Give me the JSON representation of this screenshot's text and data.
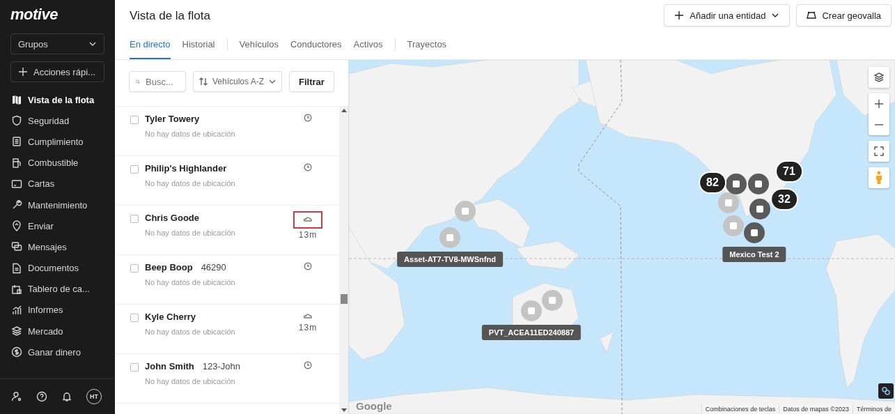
{
  "sidebar": {
    "logo": "motive",
    "groups_dropdown": "Grupos",
    "quick_actions": "Acciones rápi...",
    "nav": [
      {
        "label": "Vista de la flota",
        "selected": true
      },
      {
        "label": "Seguridad",
        "selected": false
      },
      {
        "label": "Cumplimiento",
        "selected": false
      },
      {
        "label": "Combustible",
        "selected": false
      },
      {
        "label": "Cartas",
        "selected": false
      },
      {
        "label": "Mantenimiento",
        "selected": false
      },
      {
        "label": "Enviar",
        "selected": false
      },
      {
        "label": "Mensajes",
        "selected": false
      },
      {
        "label": "Documentos",
        "selected": false
      },
      {
        "label": "Tablero de ca...",
        "selected": false
      },
      {
        "label": "Informes",
        "selected": false
      },
      {
        "label": "Mercado",
        "selected": false
      },
      {
        "label": "Ganar dinero",
        "selected": false
      }
    ],
    "avatar": "HT"
  },
  "header": {
    "title": "Vista de la flota",
    "buttons": [
      {
        "kind": "add",
        "label": "Añadir una entidad"
      },
      {
        "kind": "geofence",
        "label": "Crear geovalla"
      }
    ]
  },
  "tab_groups": [
    [
      {
        "label": "En directo",
        "selected": true
      },
      {
        "label": "Historial",
        "selected": false
      }
    ],
    [
      {
        "label": "Vehículos",
        "selected": false
      },
      {
        "label": "Conductores",
        "selected": false
      },
      {
        "label": "Activos",
        "selected": false
      }
    ],
    [
      {
        "label": "Trayectos",
        "selected": false
      }
    ]
  ],
  "toolbar": {
    "search": {
      "placeholder": "Busc..."
    },
    "sort": "Vehículos A-Z",
    "filter": "Filtrar"
  },
  "vehicles": [
    {
      "name": "Tyler Towery",
      "checked": false,
      "location": "No hay datos de ubicación",
      "kind": "clock",
      "highlighted": false
    },
    {
      "name": "Philip's Highlander",
      "checked": false,
      "location": "No hay datos de ubicación",
      "kind": "clock",
      "highlighted": false
    },
    {
      "name": "Chris Goode",
      "checked": false,
      "location": "No hay datos de ubicación",
      "kind": "cloud",
      "age": "13m",
      "highlighted": true
    },
    {
      "name": "Beep Boop",
      "code": "46290",
      "checked": false,
      "location": "No hay datos de ubicación",
      "kind": "clock",
      "highlighted": false
    },
    {
      "name": "Kyle Cherry",
      "checked": false,
      "location": "No hay datos de ubicación",
      "kind": "cloud",
      "age": "13m",
      "highlighted": false
    },
    {
      "name": "John Smith",
      "code": "123-John",
      "checked": false,
      "location": "No hay datos de ubicación",
      "kind": "clock",
      "highlighted": false
    }
  ],
  "map": {
    "markers": [
      {
        "kind": "vehicle",
        "color": "#c4c4c4"
      },
      {
        "kind": "vehicle",
        "color": "#c4c4c4",
        "label": "Asset-AT7-TV8-MWSnfnd"
      },
      {
        "kind": "vehicle",
        "color": "#c4c4c4"
      },
      {
        "kind": "vehicle",
        "color": "#c4c4c4",
        "label": "PVT_ACEA11ED240887"
      },
      {
        "kind": "vehicle",
        "color": "#c4c4c4"
      },
      {
        "kind": "vehicle",
        "color": "#c4c4c4"
      },
      {
        "kind": "vehicle",
        "color": "#5a5a5a"
      },
      {
        "kind": "vehicle",
        "color": "#5a5a5a"
      },
      {
        "kind": "vehicle",
        "color": "#5a5a5a"
      },
      {
        "kind": "vehicle",
        "color": "#5a5a5a",
        "label": "Mexico Test 2"
      },
      {
        "kind": "cluster",
        "count": "82"
      },
      {
        "kind": "cluster",
        "count": "71"
      },
      {
        "kind": "cluster",
        "count": "32"
      }
    ],
    "logo": "Google",
    "attribution": [
      "Combinaciones de teclas",
      "Datos de mapas ©2023",
      "Términos de"
    ]
  }
}
